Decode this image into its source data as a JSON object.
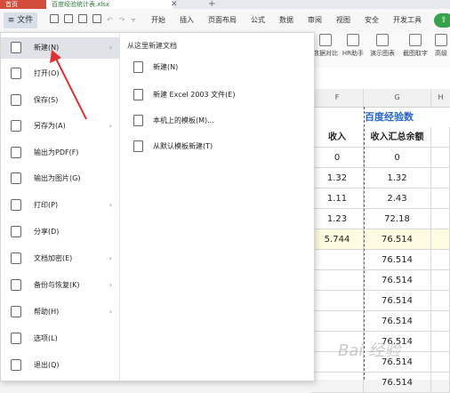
{
  "titlebar": {
    "home_tab": "首页",
    "doc_tab": "百度经验统计表.xlsx"
  },
  "menubar": {
    "file_label": "≡ 文件",
    "tabs": [
      "开始",
      "插入",
      "页面布局",
      "公式",
      "数据",
      "审阅",
      "视图",
      "安全",
      "开发工具"
    ]
  },
  "toolbar": {
    "items": [
      "数据对比",
      "HR助手",
      "演示图表",
      "截图取字",
      "高级"
    ]
  },
  "file_menu": {
    "items": [
      {
        "label": "新建(N)",
        "icon": "new-doc-icon",
        "has_arrow": true,
        "active": true
      },
      {
        "label": "打开(O)",
        "icon": "folder-icon",
        "has_arrow": false
      },
      {
        "label": "保存(S)",
        "icon": "save-icon",
        "has_arrow": false
      },
      {
        "label": "另存为(A)",
        "icon": "save-as-icon",
        "has_arrow": true
      },
      {
        "label": "输出为PDF(F)",
        "icon": "pdf-icon",
        "has_arrow": false
      },
      {
        "label": "输出为图片(G)",
        "icon": "image-icon",
        "has_arrow": false
      },
      {
        "label": "打印(P)",
        "icon": "print-icon",
        "has_arrow": true
      },
      {
        "label": "分享(D)",
        "icon": "share-icon",
        "has_arrow": false
      },
      {
        "label": "文档加密(E)",
        "icon": "lock-icon",
        "has_arrow": true
      },
      {
        "label": "备份与恢复(K)",
        "icon": "backup-icon",
        "has_arrow": true
      },
      {
        "label": "帮助(H)",
        "icon": "help-icon",
        "has_arrow": true
      },
      {
        "label": "选项(L)",
        "icon": "gear-icon",
        "has_arrow": false
      },
      {
        "label": "退出(Q)",
        "icon": "exit-icon",
        "has_arrow": false
      }
    ]
  },
  "submenu": {
    "title": "从这里新建文档",
    "items": [
      {
        "label": "新建(N)",
        "icon": "new-doc-icon"
      },
      {
        "label": "新建 Excel 2003 文件(E)",
        "icon": "excel-file-icon"
      },
      {
        "label": "本机上的模板(M)...",
        "icon": "template-icon"
      },
      {
        "label": "从默认模板新建(T)",
        "icon": "default-template-icon"
      }
    ]
  },
  "sheet": {
    "columns": [
      "F",
      "G",
      "H"
    ],
    "title": "百度经验数",
    "headers": [
      "收入",
      "收入汇总余额"
    ],
    "rows": [
      [
        "0",
        "0"
      ],
      [
        "1.32",
        "1.32"
      ],
      [
        "1.11",
        "2.43"
      ],
      [
        "1.23",
        "72.18"
      ],
      [
        "5.744",
        "76.514"
      ],
      [
        "",
        "76.514"
      ],
      [
        "",
        "76.514"
      ],
      [
        "",
        "76.514"
      ],
      [
        "",
        "76.514"
      ],
      [
        "",
        "76.514"
      ],
      [
        "",
        "76.514"
      ],
      [
        "",
        "76.514"
      ]
    ],
    "highlight_row": 4
  },
  "watermark": "Bai 经验",
  "colors": {
    "accent": "#2a66c8",
    "home_tab": "#d24d3c",
    "share": "#36a24a",
    "arrow": "#e03030",
    "highlight": "#fffbe0"
  }
}
